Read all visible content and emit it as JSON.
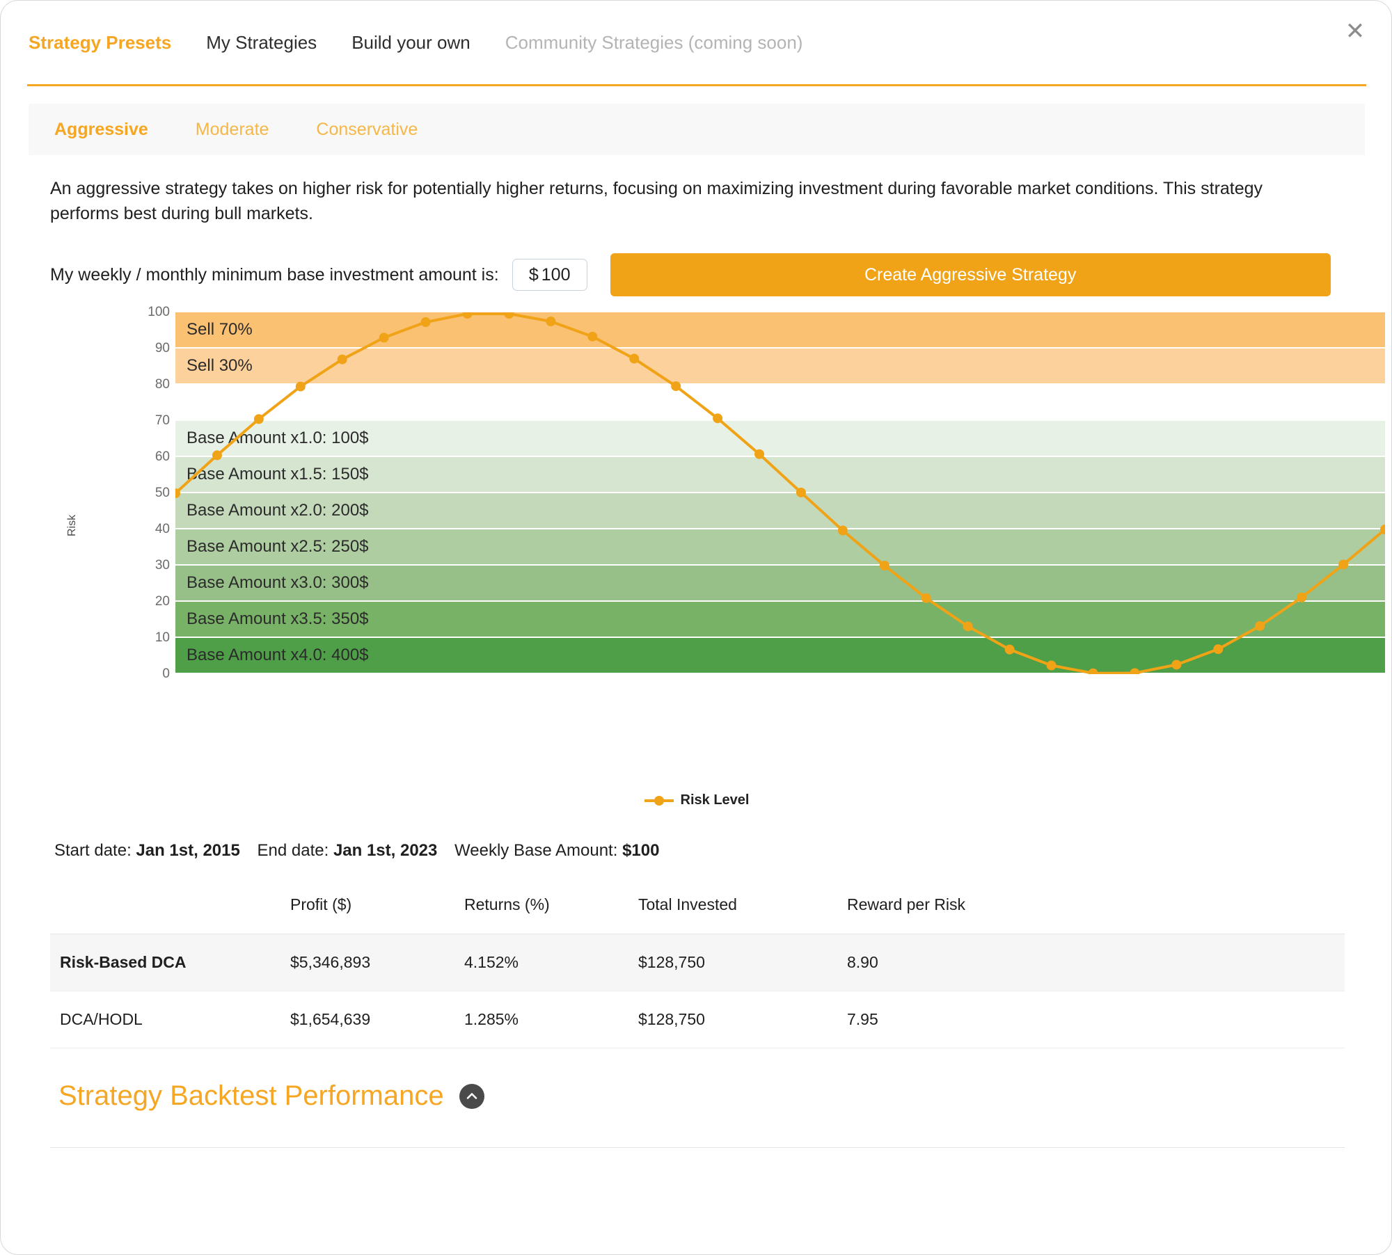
{
  "window": {
    "close_icon": "close-icon"
  },
  "tabs": [
    {
      "label": "Strategy Presets",
      "state": "active"
    },
    {
      "label": "My Strategies",
      "state": "normal"
    },
    {
      "label": "Build your own",
      "state": "normal"
    },
    {
      "label": "Community Strategies (coming soon)",
      "state": "disabled"
    }
  ],
  "subtabs": [
    {
      "label": "Aggressive",
      "state": "active"
    },
    {
      "label": "Moderate",
      "state": "normal"
    },
    {
      "label": "Conservative",
      "state": "normal"
    }
  ],
  "description": "An aggressive strategy takes on higher risk for potentially higher returns, focusing on maximizing investment during favorable market conditions. This strategy performs best during bull markets.",
  "input_row": {
    "label": "My weekly / monthly minimum base investment amount is:",
    "currency": "$",
    "amount_value": "100",
    "amount_placeholder": "100",
    "create_button": "Create Aggressive Strategy"
  },
  "chart_data": {
    "type": "line",
    "title": "",
    "xlabel": "",
    "ylabel": "Risk",
    "ylim": [
      0,
      100
    ],
    "yticks": [
      100,
      90,
      80,
      70,
      60,
      50,
      40,
      30,
      20,
      10,
      0
    ],
    "grid": false,
    "legend": {
      "position": "bottom",
      "entries": [
        "Risk Level"
      ]
    },
    "series": [
      {
        "name": "Risk Level",
        "color": "#f0a317",
        "values": [
          50,
          60.5,
          70.5,
          79.5,
          87,
          93,
          97.3,
          99.6,
          99.6,
          97.5,
          93.3,
          87.2,
          79.6,
          70.7,
          60.8,
          50.2,
          39.7,
          30,
          21,
          13.2,
          6.8,
          2.4,
          0.25,
          0.3,
          2.6,
          6.9,
          13.3,
          21.2,
          30.3,
          40
        ]
      }
    ],
    "bands": [
      {
        "from": 90,
        "to": 100,
        "label": "Sell 70%",
        "color": "#fac173"
      },
      {
        "from": 80,
        "to": 90,
        "label": "Sell 30%",
        "color": "#fdd19b"
      },
      {
        "from": 70,
        "to": 80,
        "label": "",
        "color": "#ffffff"
      },
      {
        "from": 60,
        "to": 70,
        "label": "Base Amount x1.0: 100$",
        "color": "#e8f1e5"
      },
      {
        "from": 50,
        "to": 60,
        "label": "Base Amount x1.5: 150$",
        "color": "#d6e5d0"
      },
      {
        "from": 40,
        "to": 50,
        "label": "Base Amount x2.0: 200$",
        "color": "#c4d9ba"
      },
      {
        "from": 30,
        "to": 40,
        "label": "Base Amount x2.5: 250$",
        "color": "#aecda1"
      },
      {
        "from": 20,
        "to": 30,
        "label": "Base Amount x3.0: 300$",
        "color": "#97c088"
      },
      {
        "from": 10,
        "to": 20,
        "label": "Base Amount x3.5: 350$",
        "color": "#78b266"
      },
      {
        "from": 0,
        "to": 10,
        "label": "Base Amount x4.0: 400$",
        "color": "#4f9e48"
      }
    ]
  },
  "meta": {
    "start_label": "Start date:",
    "start_value": "Jan 1st, 2015",
    "end_label": "End date:",
    "end_value": "Jan 1st, 2023",
    "base_label": "Weekly Base Amount:",
    "base_value": "$100"
  },
  "table": {
    "headers": [
      "",
      "Profit ($)",
      "Returns (%)",
      "Total Invested",
      "Reward per Risk"
    ],
    "rows": [
      {
        "name": "Risk-Based DCA",
        "profit": "$5,346,893",
        "returns": "4.152%",
        "invested": "$128,750",
        "reward": "8.90"
      },
      {
        "name": "DCA/HODL",
        "profit": "$1,654,639",
        "returns": "1.285%",
        "invested": "$128,750",
        "reward": "7.95"
      }
    ]
  },
  "backtest": {
    "title": "Strategy Backtest Performance",
    "toggle_icon": "chevron-up-icon"
  },
  "colors": {
    "accent": "#f5a623",
    "button": "#f0a317",
    "line": "#f0a317"
  }
}
